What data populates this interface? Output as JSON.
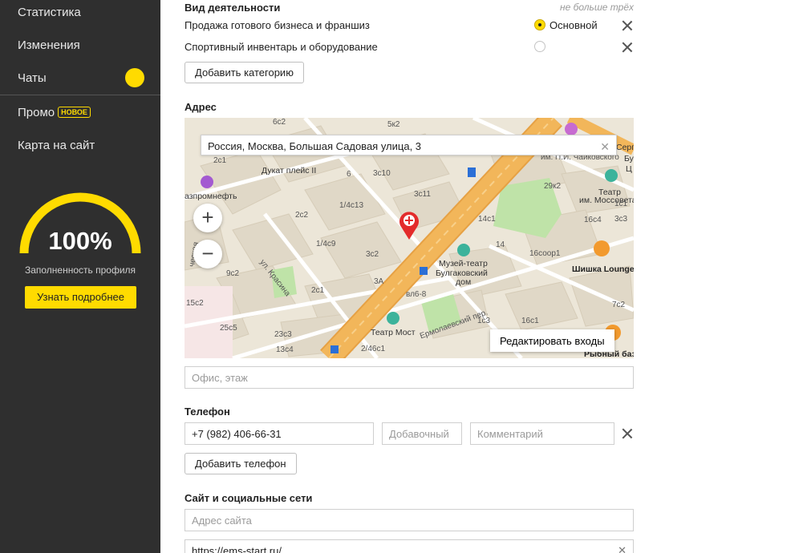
{
  "sidebar": {
    "items": [
      {
        "label": "Статистика"
      },
      {
        "label": "Изменения"
      },
      {
        "label": "Чаты"
      },
      {
        "label": "Промо",
        "badge": "НОВОЕ"
      },
      {
        "label": "Карта на сайт"
      }
    ],
    "profile": {
      "percent_label": "100%",
      "percent": 100,
      "caption": "Заполненность профиля",
      "button_label": "Узнать подробнее"
    }
  },
  "activity": {
    "title": "Вид деятельности",
    "hint": "не больше трёх",
    "categories": [
      {
        "label": "Продажа готового бизнеса и франшиз",
        "primary": true
      },
      {
        "label": "Спортивный инвентарь и оборудование",
        "primary": false
      }
    ],
    "primary_label": "Основной",
    "add_button": "Добавить категорию"
  },
  "address": {
    "title": "Адрес",
    "search_value": "Россия, Москва, Большая Садовая улица, 3",
    "edit_entrances": "Редактировать входы",
    "office_placeholder": "Офис, этаж",
    "map_labels": [
      "5к2",
      "6с2",
      "Дукат плейс II",
      "2с1",
      "6",
      "3с10",
      "3с11",
      "им. П.И. Чайковского",
      "29к2",
      "Театр",
      "им. Моссовета",
      "16с4",
      "14с1",
      "2с2",
      "1/4с13",
      "1/4с9",
      "3с2",
      "14",
      "16соор1",
      "Шишка Lounge",
      "Музей-театр",
      "Булгаковский",
      "дом",
      "ул. Красина",
      "9с2",
      "2с1",
      "3А",
      "вл6-8",
      "Театр Мост",
      "2/46с1",
      "15с2",
      "25с5",
      "23с3",
      "13с4",
      "азпромнефть",
      "ческая",
      "Ермолаевский пер.",
      "16с1",
      "Рыбный баз",
      "Серг",
      "Бу",
      "Ц",
      "3с3",
      "7с2",
      "1с3",
      "1с1"
    ],
    "colors": {
      "road_main": "#f2b65a",
      "park": "#bfe3a8",
      "building": "#e0d8c7"
    }
  },
  "phone": {
    "title": "Телефон",
    "number_value": "+7 (982) 406-66-31",
    "ext_placeholder": "Добавочный",
    "comment_placeholder": "Комментарий",
    "add_button": "Добавить телефон"
  },
  "web": {
    "title": "Сайт и социальные сети",
    "site_placeholder": "Адрес сайта",
    "site_value": "https://ems-start.ru/"
  },
  "colors": {
    "accent": "#ffdb00",
    "sidebar_bg": "#2f2f2f"
  }
}
